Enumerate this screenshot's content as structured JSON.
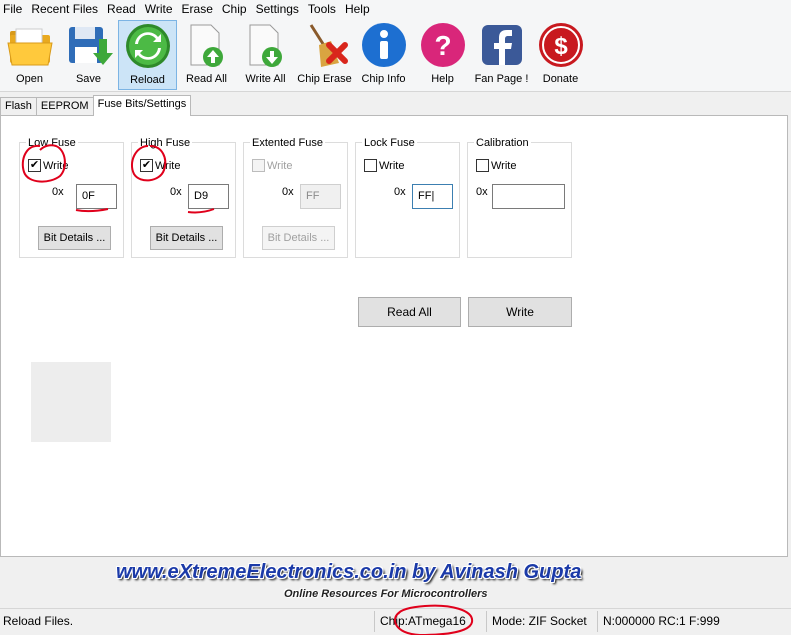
{
  "menu": [
    "File",
    "Recent Files",
    "Read",
    "Write",
    "Erase",
    "Chip",
    "Settings",
    "Tools",
    "Help"
  ],
  "toolbar": [
    {
      "label": "Open",
      "icon": "folder-open-icon"
    },
    {
      "label": "Save",
      "icon": "save-disk-icon"
    },
    {
      "label": "Reload",
      "icon": "reload-icon"
    },
    {
      "label": "Read All",
      "icon": "read-all-icon"
    },
    {
      "label": "Write All",
      "icon": "write-all-icon"
    },
    {
      "label": "Chip Erase",
      "icon": "broom-erase-icon"
    },
    {
      "label": "Chip Info",
      "icon": "info-icon"
    },
    {
      "label": "Help",
      "icon": "help-icon"
    },
    {
      "label": "Fan Page !",
      "icon": "facebook-icon"
    },
    {
      "label": "Donate",
      "icon": "dollar-icon"
    }
  ],
  "tabs": [
    "Flash",
    "EEPROM",
    "Fuse Bits/Settings"
  ],
  "active_tab": "Fuse Bits/Settings",
  "fuses": {
    "low": {
      "title": "Low Fuse",
      "write_label": "Write",
      "checked": "✔",
      "prefix": "0x",
      "value": "0F",
      "bit_details": "Bit Details ..."
    },
    "high": {
      "title": "High Fuse",
      "write_label": "Write",
      "checked": "✔",
      "prefix": "0x",
      "value": "D9",
      "bit_details": "Bit Details ..."
    },
    "extended": {
      "title": "Extented Fuse",
      "write_label": "Write",
      "checked": "",
      "prefix": "0x",
      "value": "FF",
      "bit_details": "Bit Details ..."
    },
    "lock": {
      "title": "Lock Fuse",
      "write_label": "Write",
      "checked": "",
      "prefix": "0x",
      "value": "FF|"
    },
    "calibration": {
      "title": "Calibration",
      "write_label": "Write",
      "checked": "",
      "prefix": "0x",
      "value": ""
    }
  },
  "actions": {
    "read_all": "Read All",
    "write": "Write"
  },
  "banner": {
    "title": "www.eXtremeElectronics.co.in by Avinash Gupta",
    "subtitle": "Online Resources For Microcontrollers"
  },
  "status": {
    "message": "Reload Files.",
    "chip": "Chip:ATmega16",
    "mode": "Mode: ZIF Socket",
    "counters": "N:000000 RC:1 F:999"
  },
  "colors": {
    "annotation": "#e0001b",
    "banner": "#1b3aa8",
    "active_button": "#cce4f7"
  }
}
